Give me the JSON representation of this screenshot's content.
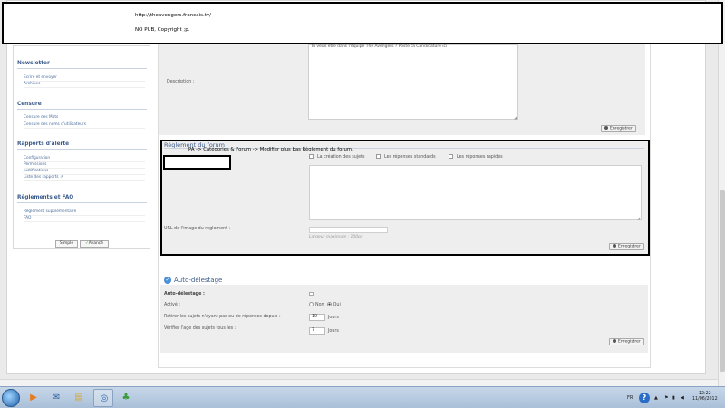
{
  "banner": {
    "url": "http://theavengers.francais.tv/",
    "note": "NO PUB, Copyright ;p."
  },
  "sidebar": {
    "sections": [
      {
        "title": "Newsletter",
        "items": [
          "Ecrire et envoyer",
          "Archives"
        ]
      },
      {
        "title": "Censure",
        "items": [
          "Censure des Mots",
          "Censure des noms d'utilisateurs"
        ]
      },
      {
        "title": "Rapports d'alerte",
        "items": [
          "Configuration",
          "Permissions",
          "Justifications",
          "Liste des rapports"
        ]
      },
      {
        "title": "Règlements et FAQ",
        "items": [
          "Règlement supplémentaire",
          "FAQ"
        ]
      }
    ],
    "mode_simple": "Simple",
    "mode_advanced": "Avancé"
  },
  "description": {
    "label": "Description :",
    "text": "Tu veux etre dans l'équipe The Avengers ? Poste ta Candidature ici !"
  },
  "buttons": {
    "save": "Enregistrer"
  },
  "rules": {
    "title": "Règlement du forum",
    "annotation": "PA -> Catégories & Forum -> Modifier plus bas Règlement du forum.",
    "checks": [
      "La création des sujets",
      "Les réponses standards",
      "Les réponses rapides"
    ],
    "url_label": "URL de l'image du règlement :",
    "url_hint": "Largeur maximale : 100px"
  },
  "auto": {
    "title": "Auto-délestage",
    "row1": "Auto-délestage :",
    "active_label": "Activé :",
    "radio_no": "Non",
    "radio_yes": "Oui",
    "remove_label": "Retirer les sujets n'ayant pas eu de réponses depuis :",
    "remove_value": "10",
    "check_label": "Vérifier l'age des sujets tous les :",
    "check_value": "7",
    "unit": "Jours"
  },
  "taskbar": {
    "lang": "FR",
    "time": "12:22",
    "date": "11/06/2012"
  }
}
